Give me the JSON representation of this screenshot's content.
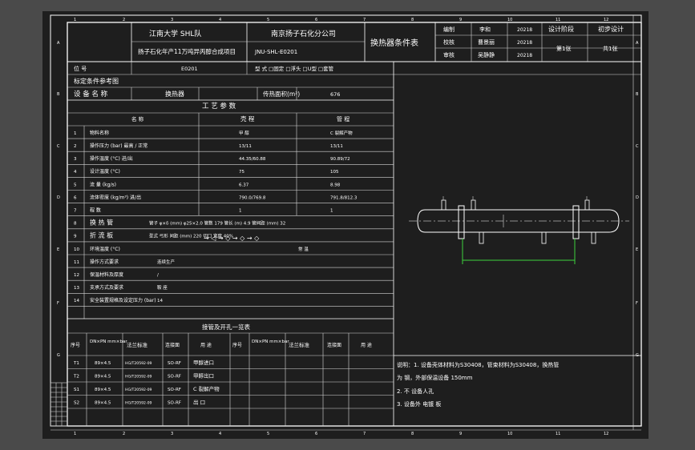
{
  "colors": {
    "frame_background": "#1e1e1e",
    "viewport_background": "#4a4a4a",
    "text": "#ffffff",
    "dimension": "#3cd23c"
  },
  "border": {
    "top_numbers": [
      "1",
      "2",
      "3",
      "4",
      "5",
      "6",
      "7",
      "8",
      "9",
      "10",
      "11",
      "12"
    ],
    "side_letters": [
      "A",
      "B",
      "C",
      "D",
      "E",
      "F",
      "G"
    ]
  },
  "title_block": {
    "university": "江南大学 SHL队",
    "company": "南京扬子石化分公司",
    "project": "扬子石化年产11万吨异丙醇合成项目",
    "drawing_no": "JNU-SHL-E0201",
    "doc_title": "换热器条件表",
    "roles": [
      "编制",
      "校核",
      "审核"
    ],
    "signers": [
      "李和",
      "曹景丽",
      "吴静静"
    ],
    "dates": [
      "20218",
      "20218",
      "20218"
    ],
    "stage_label": "设计阶段",
    "stage_value": "初步设计",
    "sheet_label": "第1张",
    "sheet_total": "共1张"
  },
  "info": {
    "position_label": "位 号",
    "position_value": "E0201",
    "type_text": "型 式 □固定 □浮头 □U型 □套管",
    "ref_label": "标定条件参考图",
    "name_label": "设 备 名 称",
    "name_value": "换热器",
    "area_label": "传热面积(m²)",
    "area_value": "676"
  },
  "process": {
    "section_title": "工 艺 参 数",
    "col_name": "名 称",
    "col_shell": "壳 程",
    "col_tube": "管 程",
    "rows": [
      {
        "no": "1",
        "name": "物料名称",
        "shell": "甲 醇",
        "tube": "C 裂解产物"
      },
      {
        "no": "2",
        "name": "操作压力 (bar) 最高 / 正常",
        "shell": "13/11",
        "tube": "13/11"
      },
      {
        "no": "3",
        "name": "操作温度 (°C) 进/出",
        "shell": "44.35/60.88",
        "tube": "90.89/72"
      },
      {
        "no": "4",
        "name": "设计温度 (°C)",
        "shell": "75",
        "tube": "105"
      },
      {
        "no": "5",
        "name": "流 量 (kg/s)",
        "shell": "6.37",
        "tube": "8.98"
      },
      {
        "no": "6",
        "name": "流体密度 (kg/m³) 进/出",
        "shell": "790.0/769.8",
        "tube": "791.8/812.3"
      },
      {
        "no": "7",
        "name": "程 数",
        "shell": "1",
        "tube": "1"
      },
      {
        "no": "8",
        "name": "换 热 管",
        "shell": "管子 φ×δ (mm) φ25×2.0 管数 179 管长 (m) 4.9 管间距 (mm) 32",
        "tube": ""
      },
      {
        "no": "9",
        "name": "折 流 板",
        "shell": "型式 弓形  间距 (mm) 220  切口  宽度 40%",
        "tube": ""
      },
      {
        "no": "10",
        "name": "环境温度 (°C)",
        "shell": "",
        "tube": "常 温"
      },
      {
        "no": "11",
        "name": "操作方式要求",
        "shell": "连续生产",
        "tube": ""
      },
      {
        "no": "12",
        "name": "保温材料及厚度",
        "shell": "/",
        "tube": ""
      },
      {
        "no": "13",
        "name": "支承方式及要求",
        "shell": "鞍 座",
        "tube": ""
      },
      {
        "no": "14",
        "name": "安全装置规格及设定压力 (bar)",
        "shell": "14",
        "tube": ""
      }
    ],
    "flow_arrows": "→ ◁ → ◇ → ◇ → ◇"
  },
  "nozzles": {
    "section_title": "接管及开孔一览表",
    "headers": [
      "序号",
      "DN×PN mm×bar",
      "法兰标准",
      "连接面",
      "用 途"
    ],
    "rows": [
      {
        "no": "T1",
        "dnpn": "89×4.5",
        "std": "HG/T20592-09",
        "face": "SO-RF",
        "use": "甲醇进口"
      },
      {
        "no": "T2",
        "dnpn": "89×4.5",
        "std": "HG/T20592-09",
        "face": "SO-RF",
        "use": "甲醇出口"
      },
      {
        "no": "S1",
        "dnpn": "89×4.5",
        "std": "HG/T20592-09",
        "face": "SO-RF",
        "use": "C 裂解产物"
      },
      {
        "no": "S2",
        "dnpn": "89×4.5",
        "std": "HG/T20592-09",
        "face": "SO-RF",
        "use": "出 口"
      }
    ]
  },
  "notes": [
    "说明：1. 设备壳体材料为S30408，管束材料为S30408，换热管",
    "为 钢，外部保温设备 150mm",
    "2. 不 设备人孔",
    "3. 设备外 电镀 板"
  ]
}
